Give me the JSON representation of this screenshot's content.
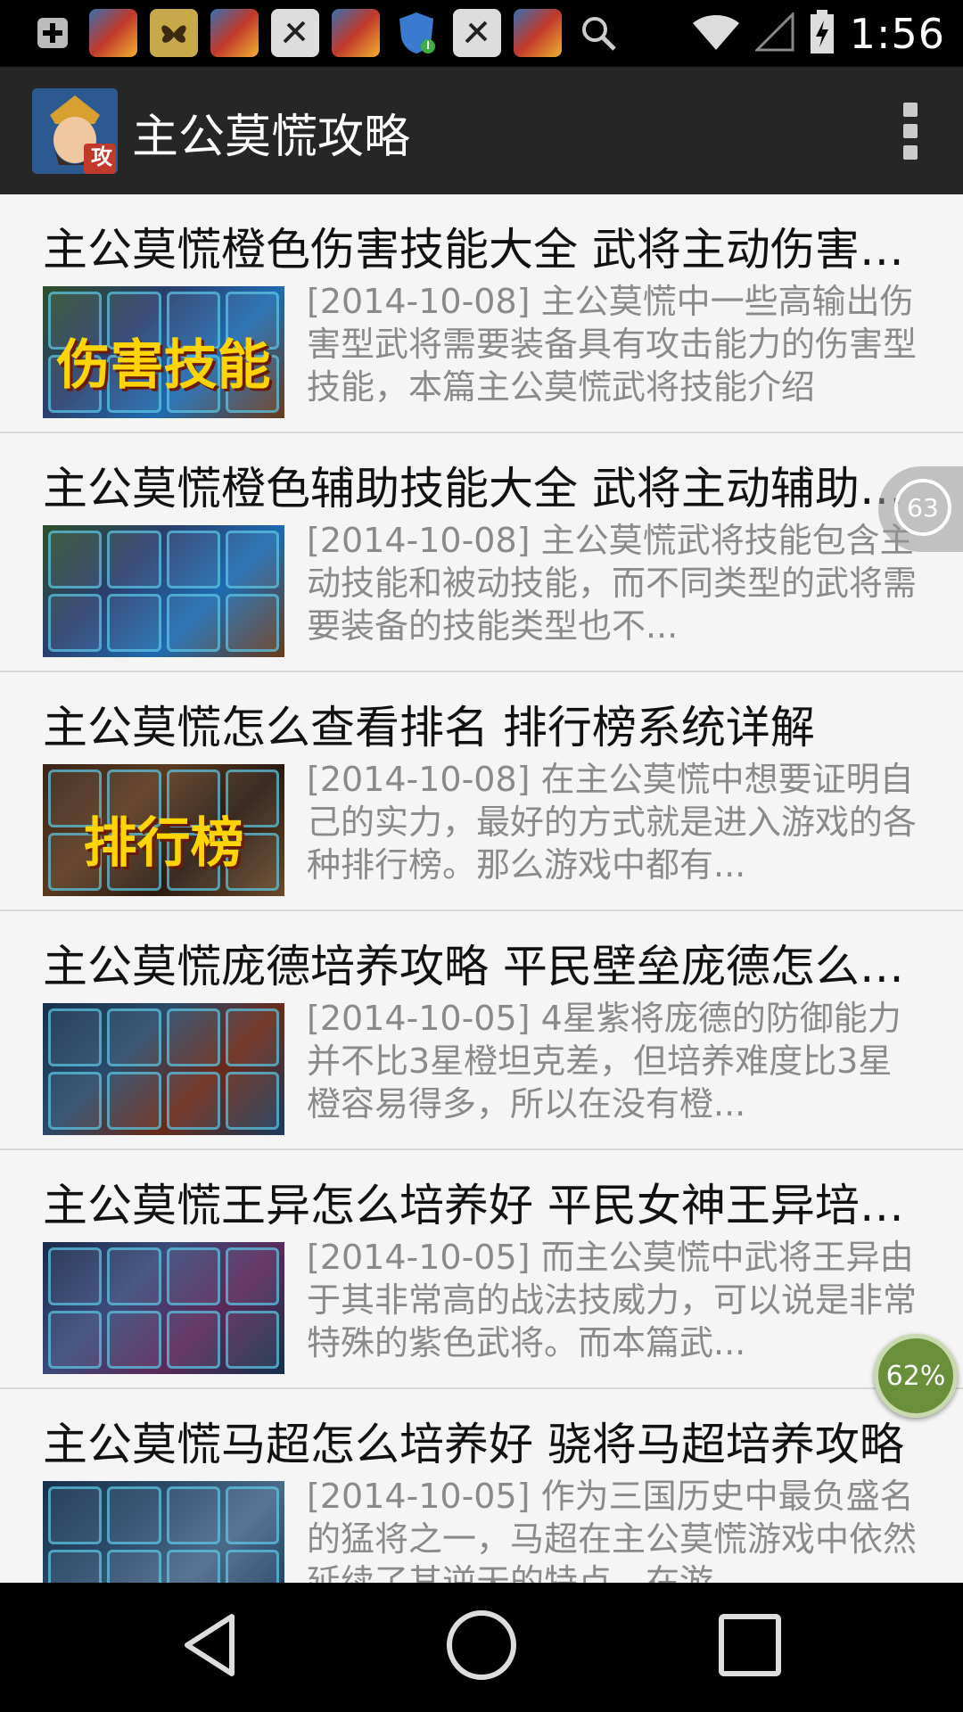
{
  "status_bar": {
    "time": "1:56",
    "icons": [
      "plus-box-icon",
      "game-avatar-icon",
      "butterfly-app-icon",
      "game-avatar-icon",
      "muted-app-icon",
      "game-avatar-icon",
      "shield-security-icon",
      "muted-app-icon",
      "game-avatar-icon",
      "search-icon",
      "wifi-icon",
      "cell-signal-icon",
      "battery-charging-icon"
    ]
  },
  "app_bar": {
    "title": "主公莫慌攻略",
    "logo_badge": "攻"
  },
  "articles": [
    {
      "title": "主公莫慌橙色伤害技能大全 武将主动伤害技能介绍",
      "summary": "[2014-10-08] 主公莫慌中一些高输出伤害型武将需要装备具有攻击能力的伤害型技能，本篇主公莫慌武将技能介绍",
      "thumb_text": "伤害技能",
      "thumb_palette": [
        "#2e4f2a",
        "#2a3f6e",
        "#1e6bb0",
        "#6a3a1a"
      ]
    },
    {
      "title": "主公莫慌橙色辅助技能大全 武将主动辅助技能介绍",
      "summary": "[2014-10-08] 主公莫慌武将技能包含主动技能和被动技能，而不同类型的武将需要装备的技能类型也不...",
      "thumb_text": "",
      "thumb_palette": [
        "#2e4f2a",
        "#2a3f6e",
        "#1e6bb0",
        "#6a3a1a"
      ]
    },
    {
      "title": "主公莫慌怎么查看排名 排行榜系统详解",
      "summary": "[2014-10-08] 在主公莫慌中想要证明自己的实力，最好的方式就是进入游戏的各种排行榜。那么游戏中都有...",
      "thumb_text": "排行榜",
      "thumb_palette": [
        "#3a2418",
        "#5a3a20",
        "#2a1a10",
        "#6a4a2a"
      ]
    },
    {
      "title": "主公莫慌庞德培养攻略 平民壁垒庞德怎么培养",
      "summary": "[2014-10-05] 4星紫将庞德的防御能力并不比3星橙坦克差，但培养难度比3星橙容易得多，所以在没有橙...",
      "thumb_text": "",
      "thumb_palette": [
        "#16304a",
        "#2a4a6a",
        "#6a2a1a",
        "#1a3a5a"
      ]
    },
    {
      "title": "主公莫慌王异怎么培养好 平民女神王异培养攻略",
      "summary": "[2014-10-05] 而主公莫慌中武将王异由于其非常高的战法技威力，可以说是非常特殊的紫色武将。而本篇武...",
      "thumb_text": "",
      "thumb_palette": [
        "#1a2a4a",
        "#3a4a7a",
        "#5a2a5a",
        "#16304a"
      ]
    },
    {
      "title": "主公莫慌马超怎么培养好 骁将马超培养攻略",
      "summary": "[2014-10-05] 作为三国历史中最负盛名的猛将之一，马超在主公莫慌游戏中依然延续了其逆天的特点，在游...",
      "thumb_text": "",
      "thumb_palette": [
        "#16304a",
        "#2a4a6a",
        "#4a6a8a",
        "#1a3a5a"
      ]
    }
  ],
  "floating": {
    "counter_badge": "63",
    "progress_badge": "62%"
  }
}
